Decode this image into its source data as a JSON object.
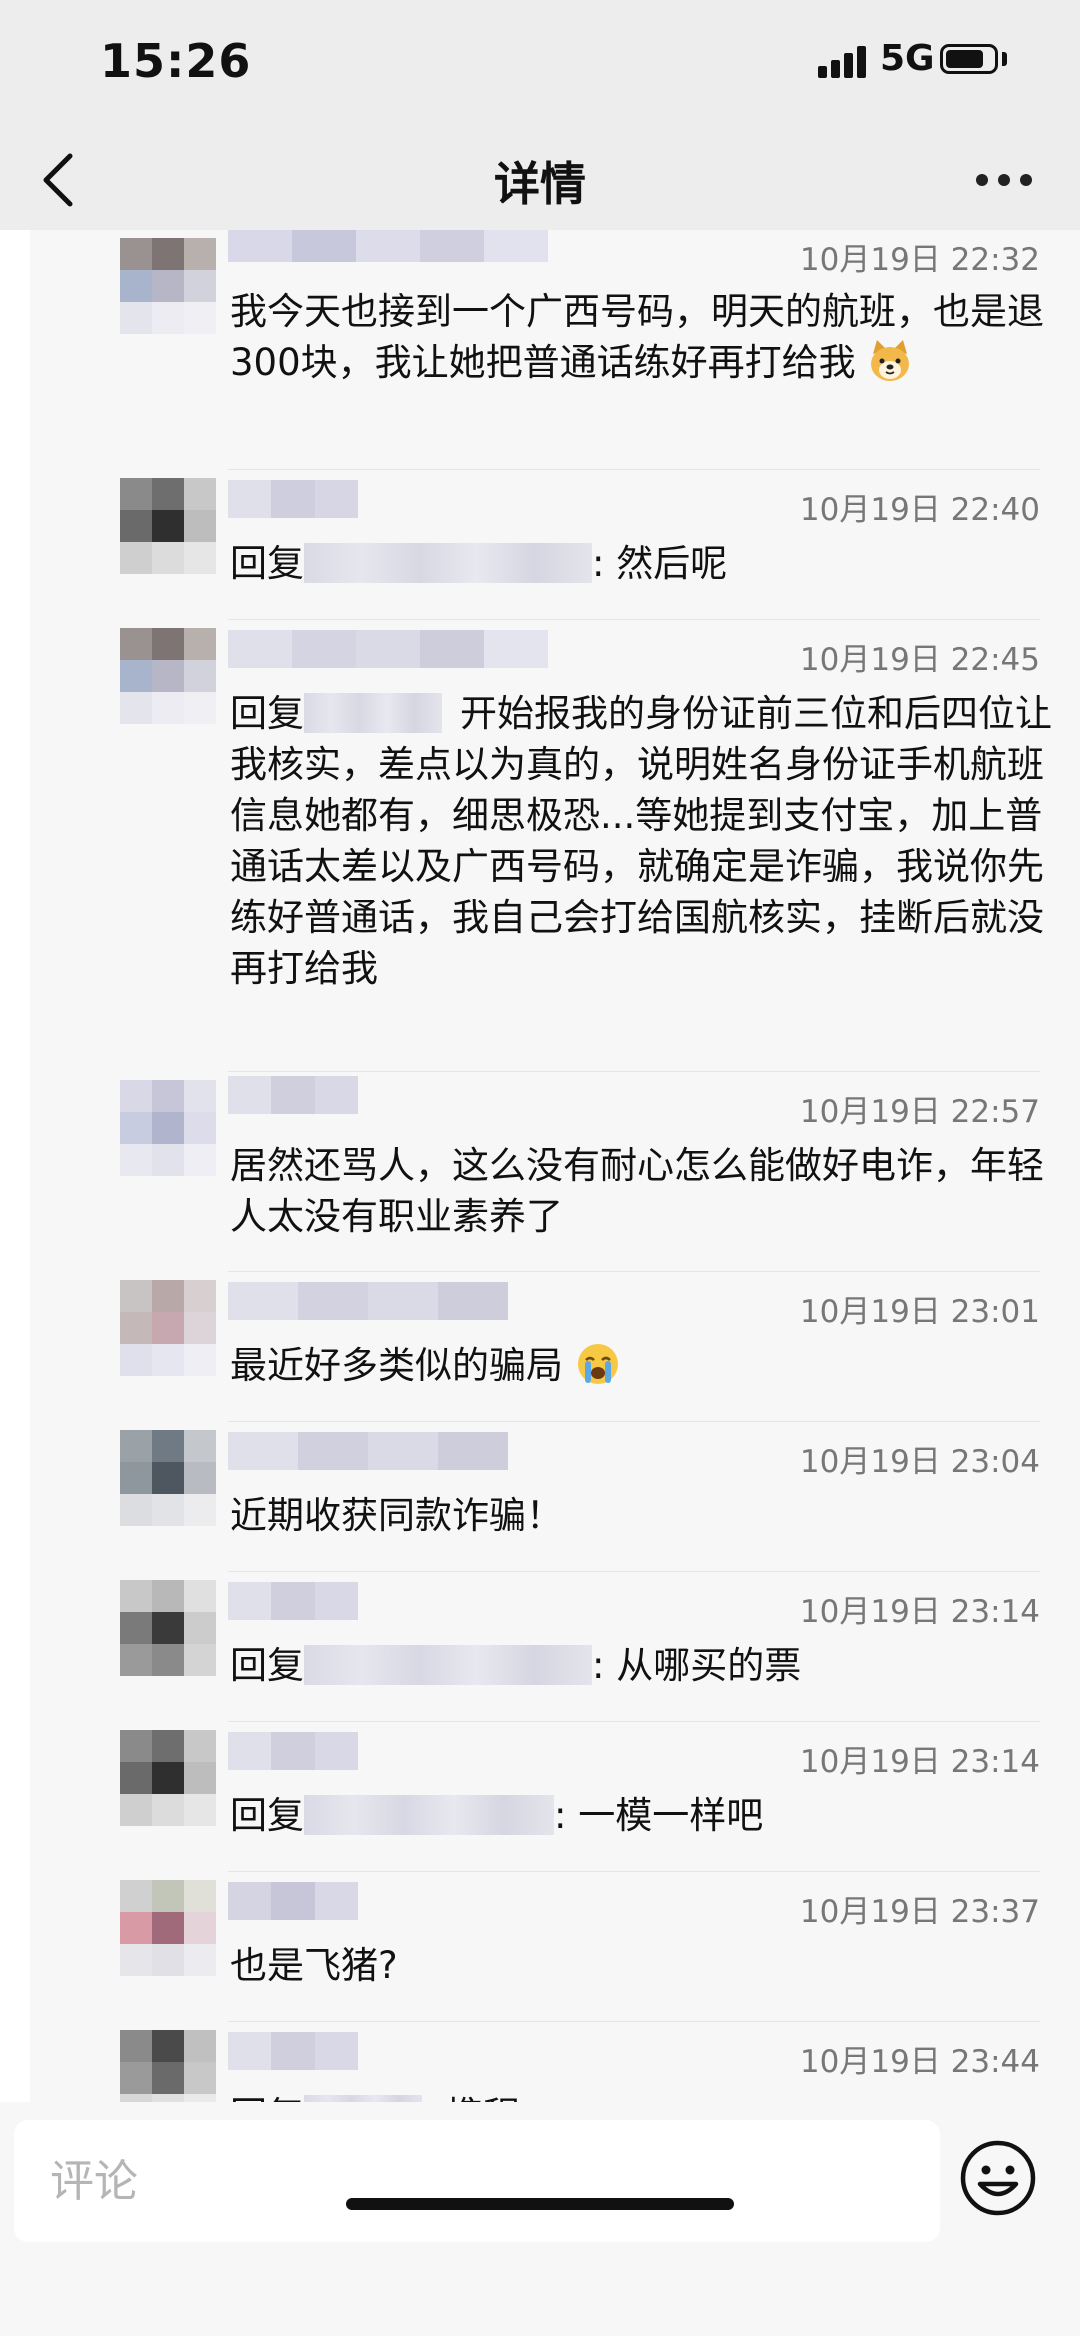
{
  "status_bar": {
    "time": "15:26",
    "network": "5G",
    "battery_level": 0.8
  },
  "header": {
    "title": "详情",
    "back_icon": "chevron-left-icon",
    "more_icon": "more-horizontal-icon"
  },
  "comments": [
    {
      "timestamp": "10月19日 22:32",
      "text": "我今天也接到一个广西号码，明天的航班，也是退300块，我让她把普通话练好再打给我",
      "emoji": "dog-face-emoji"
    },
    {
      "timestamp": "10月19日 22:40",
      "reply_prefix": "回复",
      "text": ": 然后呢"
    },
    {
      "timestamp": "10月19日 22:45",
      "reply_prefix": "回复",
      "text": "开始报我的身份证前三位和后四位让我核实，差点以为真的，说明姓名身份证手机航班信息她都有，细思极恐...等她提到支付宝，加上普通话太差以及广西号码，就确定是诈骗，我说你先练好普通话，我自己会打给国航核实，挂断后就没再打给我"
    },
    {
      "timestamp": "10月19日 22:57",
      "text": "居然还骂人，这么没有耐心怎么能做好电诈，年轻人太没有职业素养了"
    },
    {
      "timestamp": "10月19日 23:01",
      "text": "最近好多类似的骗局",
      "emoji": "crying-face-emoji"
    },
    {
      "timestamp": "10月19日 23:04",
      "text": "近期收获同款诈骗！"
    },
    {
      "timestamp": "10月19日 23:14",
      "reply_prefix": "回复",
      "text": ": 从哪买的票"
    },
    {
      "timestamp": "10月19日 23:14",
      "reply_prefix": "回复",
      "text": ": 一模一样吧"
    },
    {
      "timestamp": "10月19日 23:37",
      "text": "也是飞猪?"
    },
    {
      "timestamp": "10月19日 23:44",
      "reply_prefix": "回复",
      "text": ": 携程"
    }
  ],
  "input": {
    "placeholder": "评论",
    "emoji_icon": "smiley-face-icon"
  },
  "colors": {
    "bar_background": "#ededed",
    "content_background": "#f7f7f7",
    "timestamp": "#777777"
  }
}
